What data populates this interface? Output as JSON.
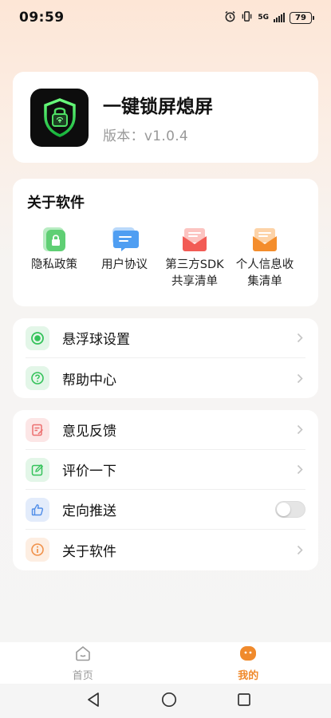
{
  "status_bar": {
    "time": "09:59",
    "network": "5G",
    "battery": "79"
  },
  "app": {
    "name": "一键锁屏熄屏",
    "version": "版本：v1.0.4"
  },
  "about": {
    "title": "关于软件",
    "items": [
      {
        "label": "隐私政策",
        "icon": "privacy-lock-icon",
        "color": "#5fcf74"
      },
      {
        "label": "用户协议",
        "icon": "chat-document-icon",
        "color": "#4f9ef2"
      },
      {
        "label": "第三方SDK 共享清单",
        "line1": "第三方SDK",
        "line2": "共享清单",
        "icon": "red-mail-icon",
        "color": "#f25b55"
      },
      {
        "label": "个人信息收集清单",
        "line1": "个人信息收",
        "line2": "集清单",
        "icon": "orange-mail-icon",
        "color": "#f48d2c"
      }
    ]
  },
  "settings_group_1": [
    {
      "label": "悬浮球设置",
      "icon": "floating-ball-icon",
      "color": "#34c25a"
    },
    {
      "label": "帮助中心",
      "icon": "help-icon",
      "color": "#34c25a"
    }
  ],
  "settings_group_2": [
    {
      "label": "意见反馈",
      "icon": "feedback-icon",
      "color": "#ec6f6f"
    },
    {
      "label": "评价一下",
      "icon": "rate-icon",
      "color": "#34c25a"
    },
    {
      "label": "定向推送",
      "icon": "thumbs-up-icon",
      "color": "#4f8de8",
      "toggle": false
    },
    {
      "label": "关于软件",
      "icon": "info-icon",
      "color": "#f0914a"
    }
  ],
  "bottom_nav": {
    "home": "首页",
    "mine": "我的",
    "active": "mine",
    "active_color": "#f08a2c"
  }
}
